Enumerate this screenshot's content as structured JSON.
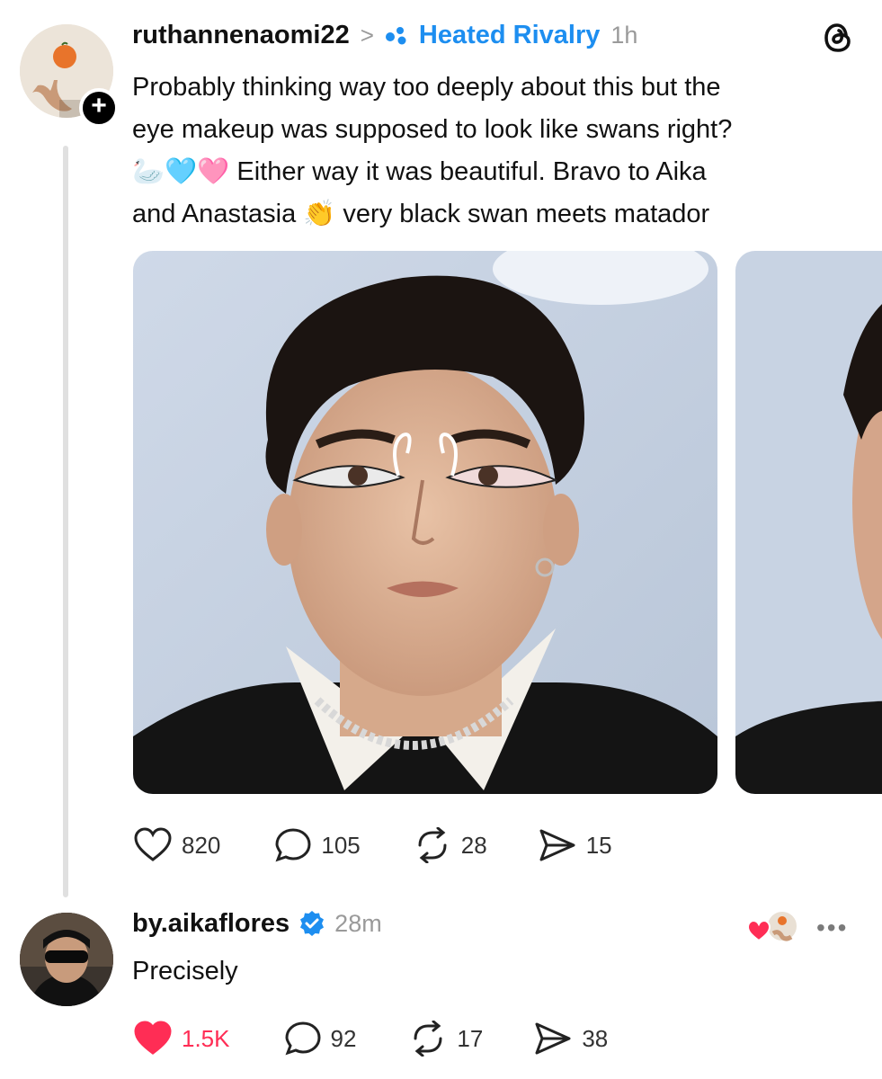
{
  "post": {
    "username": "ruthannenaomi22",
    "separator": ">",
    "community": "Heated Rivalry",
    "time": "1h",
    "text_lines": [
      "Probably thinking way too deeply about this but the",
      "eye makeup was supposed to look like swans right?",
      "🦢🩵🩷 Either way it was beautiful. Bravo to Aika",
      "and Anastasia 👏 very black swan meets matador"
    ],
    "actions": {
      "likes": "820",
      "comments": "105",
      "reposts": "28",
      "shares": "15"
    }
  },
  "reply": {
    "username": "by.aikaflores",
    "time": "28m",
    "text": "Precisely",
    "actions": {
      "likes": "1.5K",
      "comments": "92",
      "reposts": "17",
      "shares": "38"
    },
    "more": "•••"
  },
  "colors": {
    "accent": "#1d8ef0",
    "like_active": "#ff2d55",
    "muted": "#9a9a9a"
  }
}
